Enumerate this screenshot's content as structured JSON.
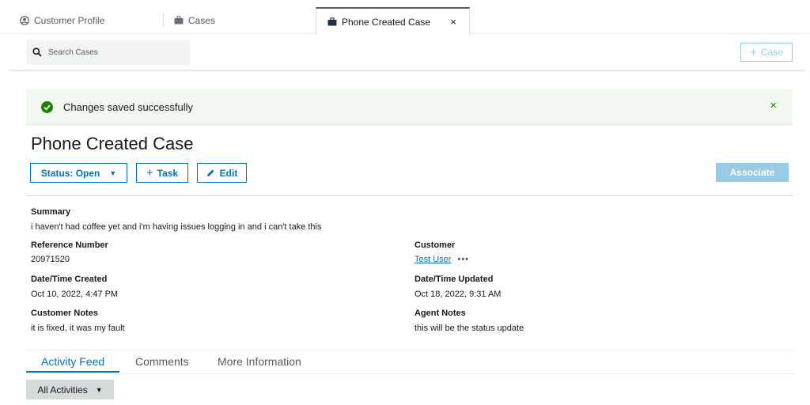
{
  "tabs": {
    "profile_label": "Customer Profile",
    "cases_label": "Cases",
    "active_label": "Phone Created Case",
    "close_glyph": "×"
  },
  "search": {
    "placeholder": "Search Cases",
    "value": ""
  },
  "add_case_button": {
    "plus": "+",
    "label": "Case"
  },
  "flash": {
    "message": "Changes saved successfully",
    "close_glyph": "×",
    "color": "#1d8102"
  },
  "page_title": "Phone Created Case",
  "actions": {
    "status_label": "Status: Open",
    "caret": "▼",
    "task_plus": "+",
    "task_label": "Task",
    "edit_label": "Edit",
    "associate_label": "Associate"
  },
  "details": {
    "summary_label": "Summary",
    "summary_value": "i haven't had coffee yet and i'm having issues logging in and i can't take this",
    "reference_label": "Reference Number",
    "reference_value": "20971520",
    "customer_label": "Customer",
    "customer_value": "Test User",
    "customer_more": "•••",
    "created_label": "Date/Time Created",
    "created_value": "Oct 10, 2022, 4:47 PM",
    "updated_label": "Date/Time Updated",
    "updated_value": "Oct 18, 2022, 9:31 AM",
    "customer_notes_label": "Customer Notes",
    "customer_notes_value": "it is fixed, it was my fault",
    "agent_notes_label": "Agent Notes",
    "agent_notes_value": "this will be the status update"
  },
  "bottom_tabs": {
    "activity_feed": "Activity Feed",
    "comments": "Comments",
    "more_information": "More Information"
  },
  "filter": {
    "label": "All Activities",
    "caret": "▼"
  },
  "colors": {
    "accent": "#0073bb",
    "disabled_accent": "#99cbe4",
    "success": "#1d8102"
  }
}
